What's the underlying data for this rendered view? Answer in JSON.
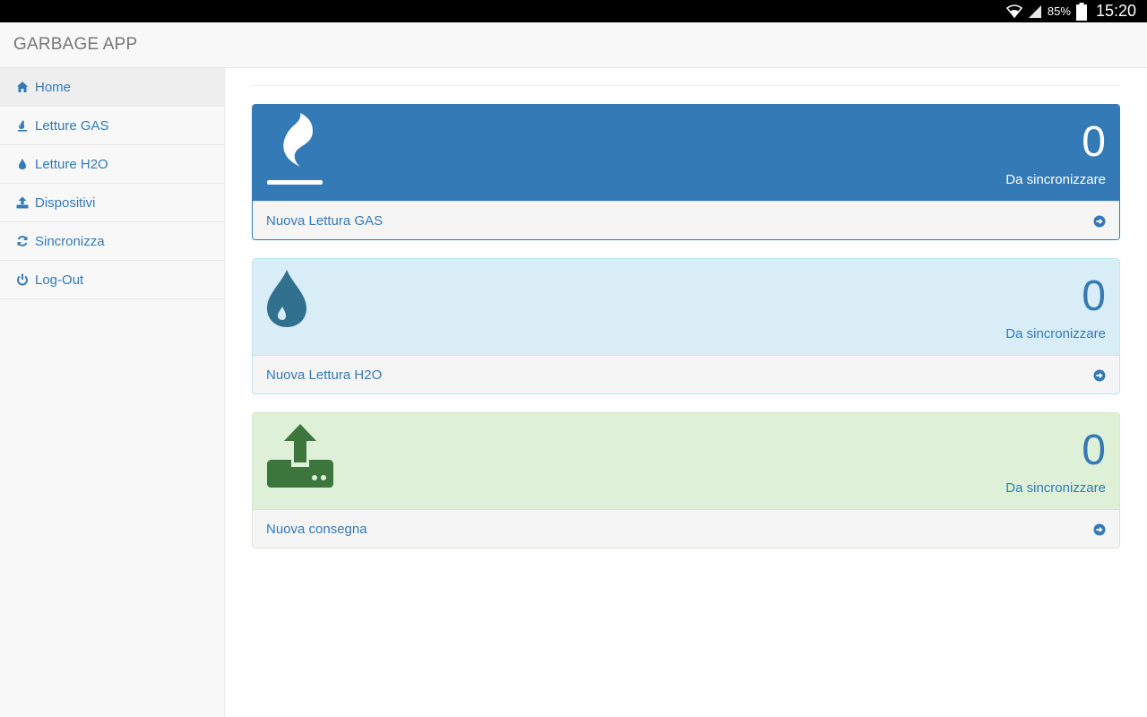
{
  "statusbar": {
    "battery_pct": "85%",
    "time": "15:20"
  },
  "app": {
    "title": "GARBAGE APP"
  },
  "sidebar": {
    "items": [
      {
        "label": "Home",
        "icon": "home-icon"
      },
      {
        "label": "Letture GAS",
        "icon": "fire-icon"
      },
      {
        "label": "Letture H2O",
        "icon": "tint-icon"
      },
      {
        "label": "Dispositivi",
        "icon": "upload-icon"
      },
      {
        "label": "Sincronizza",
        "icon": "refresh-icon"
      },
      {
        "label": "Log-Out",
        "icon": "power-icon"
      }
    ]
  },
  "panels": {
    "gas": {
      "count": "0",
      "subtitle": "Da sincronizzare",
      "link": "Nuova Lettura GAS",
      "icon": "gas-flame-icon"
    },
    "h2o": {
      "count": "0",
      "subtitle": "Da sincronizzare",
      "link": "Nuova Lettura H2O",
      "icon": "water-drop-icon"
    },
    "consegna": {
      "count": "0",
      "subtitle": "Da sincronizzare",
      "link": "Nuova consegna",
      "icon": "upload-tray-icon"
    }
  },
  "colors": {
    "primary": "#337ab7",
    "info_bg": "#d9edf7",
    "success_bg": "#dff0d8",
    "success_icon": "#3c763d",
    "info_icon": "#31708f"
  }
}
